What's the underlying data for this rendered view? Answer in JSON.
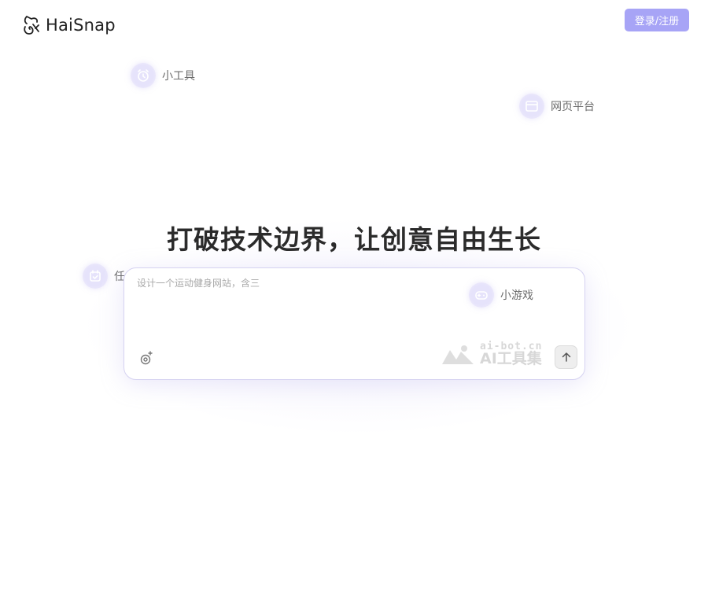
{
  "header": {
    "logo_text": "HaiSnap",
    "login_label": "登录/注册"
  },
  "tags": [
    {
      "label": "小工具",
      "icon": "alarm-clock-icon"
    },
    {
      "label": "网页平台",
      "icon": "browser-window-icon"
    },
    {
      "label": "任务管理",
      "icon": "calendar-check-icon"
    },
    {
      "label": "小游戏",
      "icon": "gamepad-icon"
    }
  ],
  "main": {
    "headline": "打破技术边界，让创意自由生长",
    "prompt_placeholder": "设计一个运动健身网站，含三"
  },
  "watermark": {
    "url": "ai-bot.cn",
    "name": "AI工具集"
  },
  "colors": {
    "accent": "#a7a4f6",
    "icon_bg": "#e6e3fb"
  }
}
